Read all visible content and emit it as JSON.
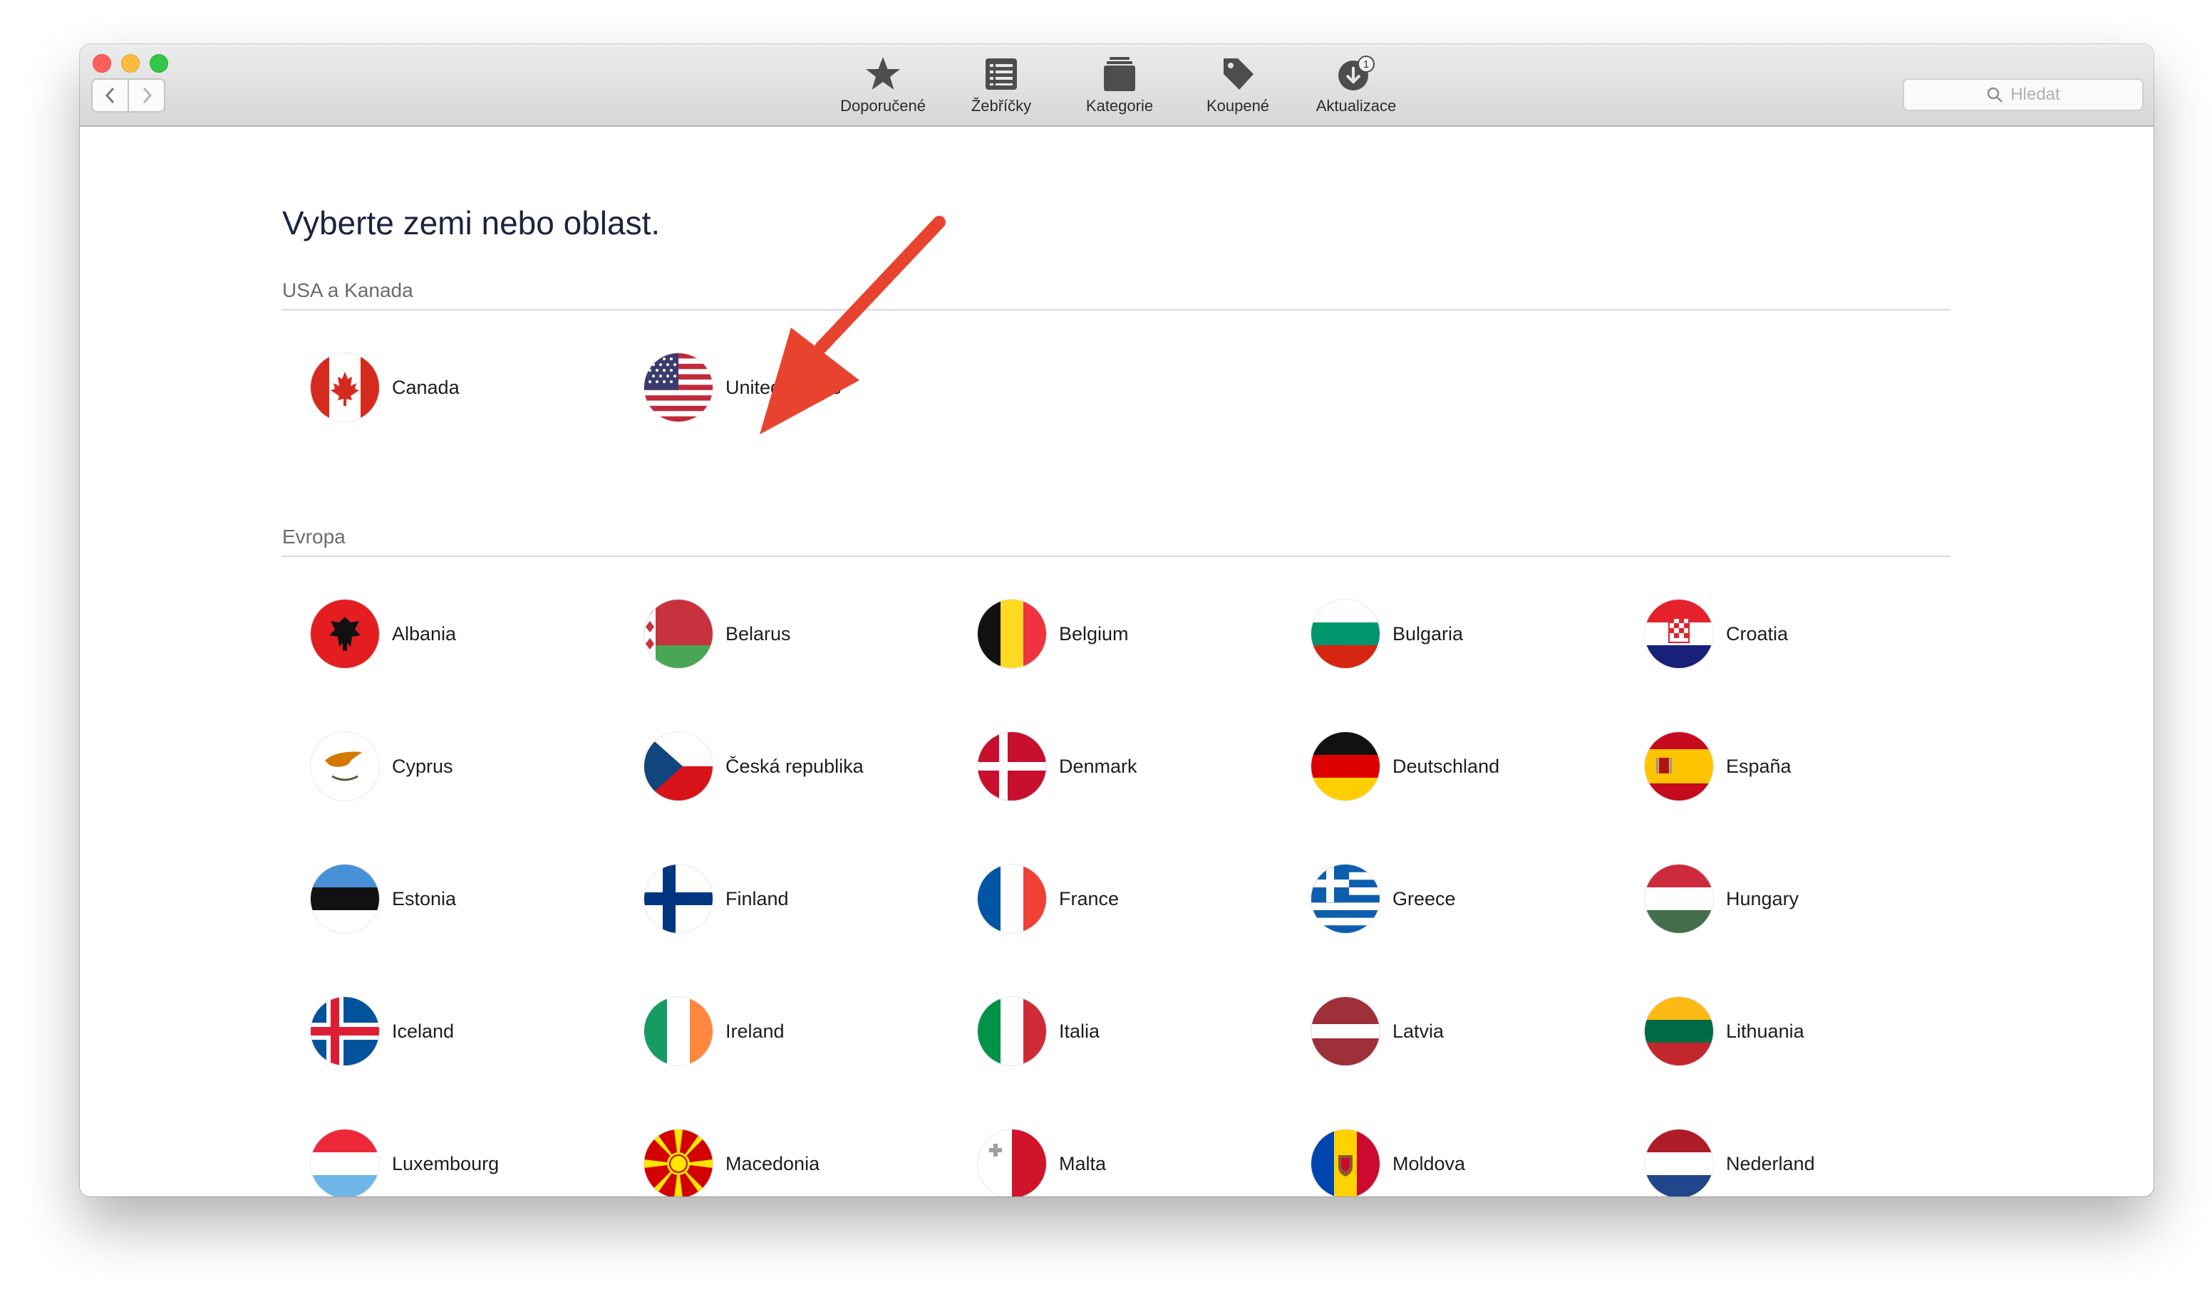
{
  "window": {
    "toolbar": [
      {
        "label": "Doporučené",
        "icon": "star-icon"
      },
      {
        "label": "Žebříčky",
        "icon": "list-icon"
      },
      {
        "label": "Kategorie",
        "icon": "categories-icon"
      },
      {
        "label": "Koupené",
        "icon": "tag-icon"
      },
      {
        "label": "Aktualizace",
        "icon": "updates-icon",
        "badge": "1"
      }
    ],
    "search_placeholder": "Hledat"
  },
  "page": {
    "title": "Vyberte zemi nebo oblast.",
    "sections": [
      {
        "title": "USA a Kanada",
        "countries": [
          "Canada",
          "United States"
        ]
      },
      {
        "title": "Evropa",
        "countries": [
          "Albania",
          "Belarus",
          "Belgium",
          "Bulgaria",
          "Croatia",
          "Cyprus",
          "Česká republika",
          "Denmark",
          "Deutschland",
          "España",
          "Estonia",
          "Finland",
          "France",
          "Greece",
          "Hungary",
          "Iceland",
          "Ireland",
          "Italia",
          "Latvia",
          "Lithuania",
          "Luxembourg",
          "Macedonia",
          "Malta",
          "Moldova",
          "Nederland"
        ]
      }
    ]
  },
  "colors": {
    "annotation_arrow": "#e8432e",
    "title": "#1b2340"
  }
}
